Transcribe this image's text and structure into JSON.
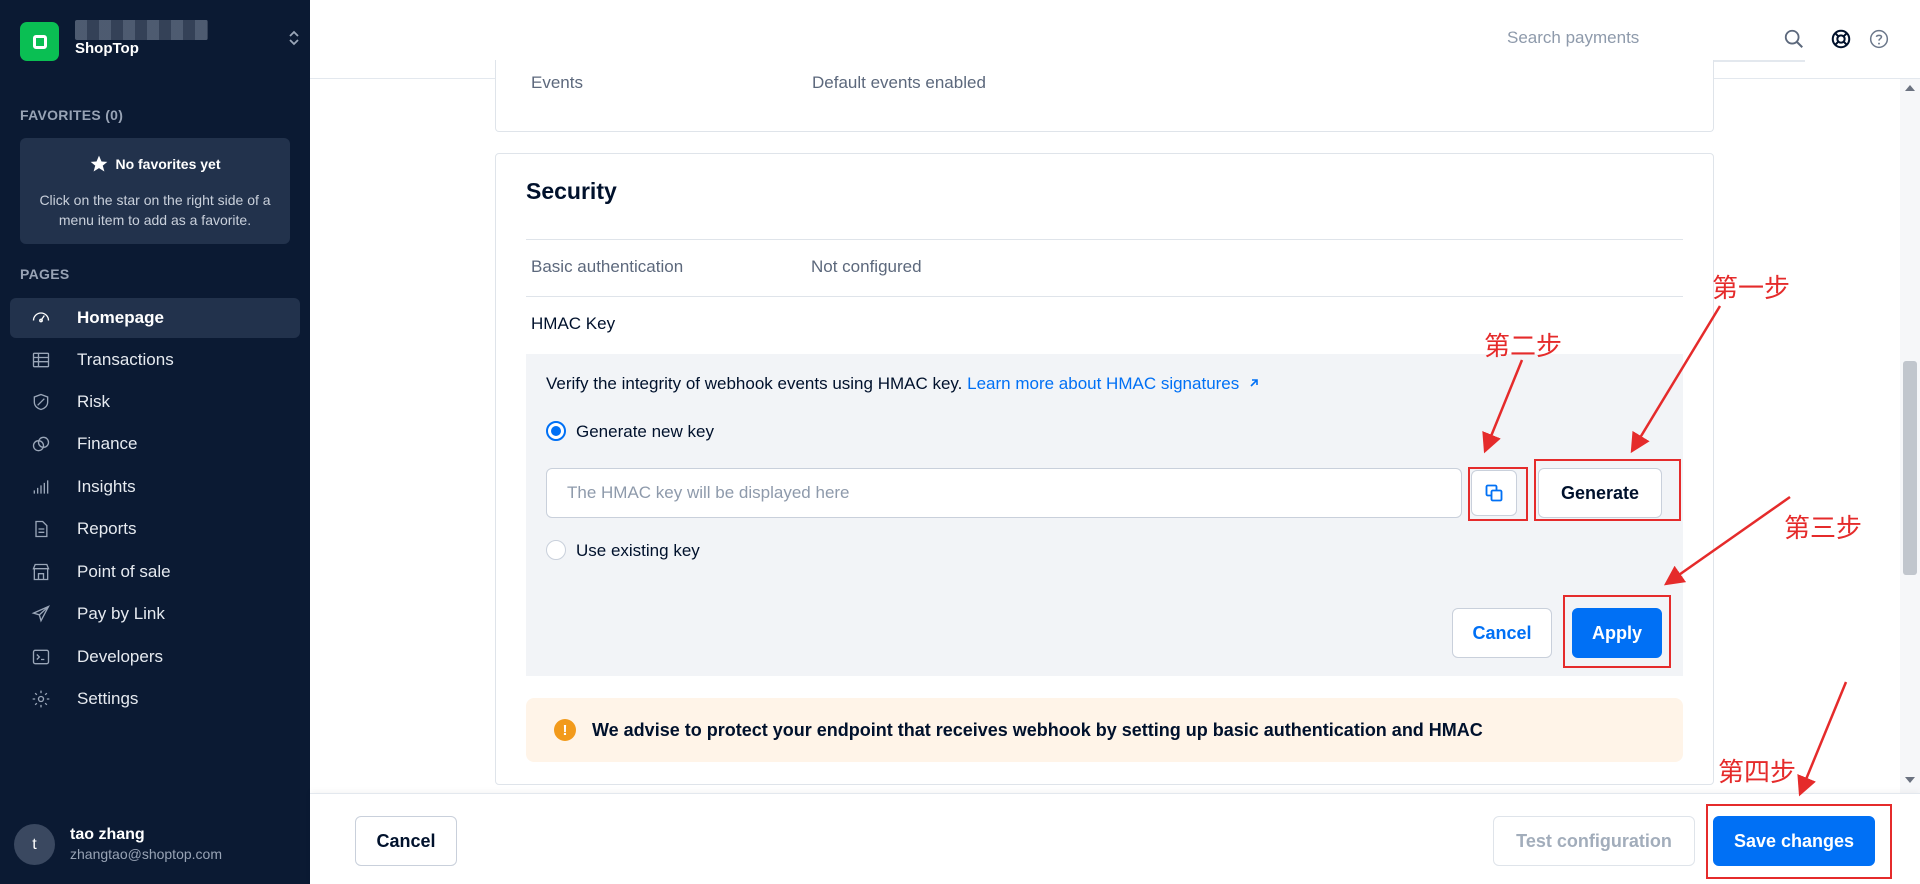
{
  "sidebar": {
    "brand_name": "ShopTop",
    "favorites_heading": "FAVORITES (0)",
    "favorites_empty_title": "No favorites yet",
    "favorites_empty_desc": "Click on the star on the right side of a menu item to add as a favorite.",
    "pages_heading": "PAGES",
    "items": [
      {
        "label": "Homepage",
        "icon": "gauge-icon",
        "active": true
      },
      {
        "label": "Transactions",
        "icon": "table-icon"
      },
      {
        "label": "Risk",
        "icon": "shield-icon"
      },
      {
        "label": "Finance",
        "icon": "coins-icon"
      },
      {
        "label": "Insights",
        "icon": "bar-chart-icon"
      },
      {
        "label": "Reports",
        "icon": "document-icon"
      },
      {
        "label": "Point of sale",
        "icon": "store-icon"
      },
      {
        "label": "Pay by Link",
        "icon": "paper-plane-icon"
      },
      {
        "label": "Developers",
        "icon": "terminal-icon"
      },
      {
        "label": "Settings",
        "icon": "gear-icon"
      }
    ],
    "user": {
      "initial": "t",
      "name": "tao zhang",
      "email": "zhangtao@shoptop.com"
    }
  },
  "header": {
    "search_placeholder": "Search payments"
  },
  "events_row": {
    "label": "Events",
    "value": "Default events enabled"
  },
  "security": {
    "title": "Security",
    "basic_auth_label": "Basic authentication",
    "basic_auth_value": "Not configured",
    "hmac_title": "HMAC Key",
    "hmac_desc": "Verify the integrity of webhook events using HMAC key.",
    "hmac_link": "Learn more about HMAC signatures",
    "option_generate": "Generate new key",
    "option_existing": "Use existing key",
    "selected_option": "generate",
    "key_placeholder": "The HMAC key will be displayed here",
    "generate_label": "Generate",
    "cancel_label": "Cancel",
    "apply_label": "Apply",
    "warning_text": "We advise to protect your endpoint that receives webhook by setting up basic authentication and HMAC"
  },
  "footer": {
    "cancel_label": "Cancel",
    "test_label": "Test configuration",
    "save_label": "Save changes"
  },
  "annotations": {
    "step1": "第一步",
    "step2": "第二步",
    "step3": "第三步",
    "step4": "第四步"
  },
  "colors": {
    "sidebar_bg": "#0b1a33",
    "brand_green": "#0abf53",
    "primary_blue": "#0070f5",
    "annotation_red": "#e52b2b",
    "warning_bg": "#fff4e8",
    "warning_orange": "#f29a1b"
  }
}
